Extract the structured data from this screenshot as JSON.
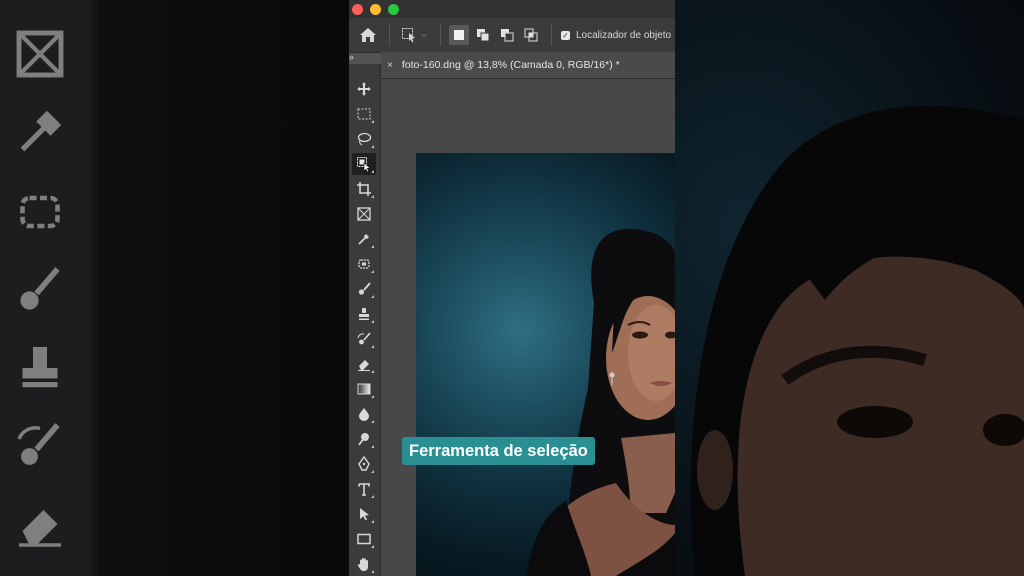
{
  "window": {
    "controls": [
      "close",
      "minimize",
      "zoom"
    ]
  },
  "options_bar": {
    "home_icon": "home-icon",
    "tool_preset_icon": "object-selection-preset-icon",
    "selection_modes": [
      "new-selection",
      "add-to-selection",
      "subtract-from-selection",
      "intersect-with-selection"
    ],
    "object_finder_label": "Localizador de objeto",
    "object_finder_checked": true
  },
  "document_tab": {
    "title": "foto-160.dng @ 13,8% (Camada 0, RGB/16*) *",
    "close_symbol": "×"
  },
  "toolbar": {
    "collapse_symbol": "»",
    "tools": [
      "move-tool",
      "rectangular-marquee-tool",
      "lasso-tool",
      "object-selection-tool",
      "crop-tool",
      "frame-tool",
      "eyedropper-tool",
      "spot-healing-tool",
      "brush-tool",
      "clone-stamp-tool",
      "history-brush-tool",
      "eraser-tool",
      "gradient-tool",
      "blur-tool",
      "dodge-tool",
      "pen-tool",
      "type-tool",
      "path-selection-tool",
      "rectangle-tool",
      "hand-tool"
    ],
    "selected_tool": "object-selection-tool"
  },
  "caption": {
    "text": "Ferramenta de seleção",
    "background": "#2a8f93"
  },
  "colors": {
    "panel": "#3b3b3b",
    "canvas_bg": "#484848",
    "photo_backdrop": "#1c4d5e"
  }
}
